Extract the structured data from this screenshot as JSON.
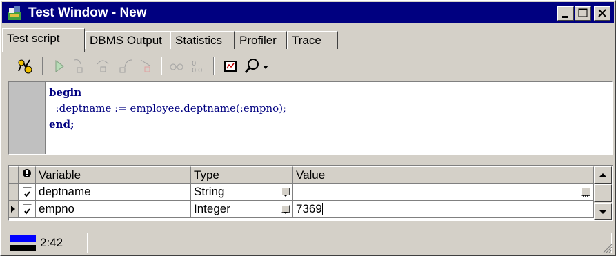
{
  "window": {
    "title": "Test Window - New",
    "controls": {
      "minimize": "minimize-icon",
      "maximize": "maximize-icon",
      "close": "close-icon"
    }
  },
  "tabs": [
    {
      "label": "Test script",
      "active": true
    },
    {
      "label": "DBMS Output",
      "active": false
    },
    {
      "label": "Statistics",
      "active": false
    },
    {
      "label": "Profiler",
      "active": false
    },
    {
      "label": "Trace",
      "active": false
    }
  ],
  "toolbar": {
    "items": [
      "execute-icon",
      "run-icon",
      "step-into-icon",
      "step-over-icon",
      "step-out-icon",
      "run-to-exception-icon",
      "view-variables-icon",
      "set-variable-icon",
      "graph-icon",
      "search-icon"
    ]
  },
  "editor": {
    "lines": [
      {
        "keyword": "begin",
        "text": ""
      },
      {
        "keyword": "",
        "text": "  :deptname := employee.deptname(:empno);"
      },
      {
        "keyword": "end;",
        "text": ""
      }
    ]
  },
  "variables": {
    "columns": {
      "flag": "❶",
      "name": "Variable",
      "type": "Type",
      "value": "Value"
    },
    "rows": [
      {
        "checked": true,
        "name": "deptname",
        "type": "String",
        "value": "",
        "current": false
      },
      {
        "checked": true,
        "name": "empno",
        "type": "Integer",
        "value": "7369",
        "current": true
      }
    ]
  },
  "status": {
    "position": "2:42",
    "colors": {
      "accent": "#000080"
    }
  }
}
